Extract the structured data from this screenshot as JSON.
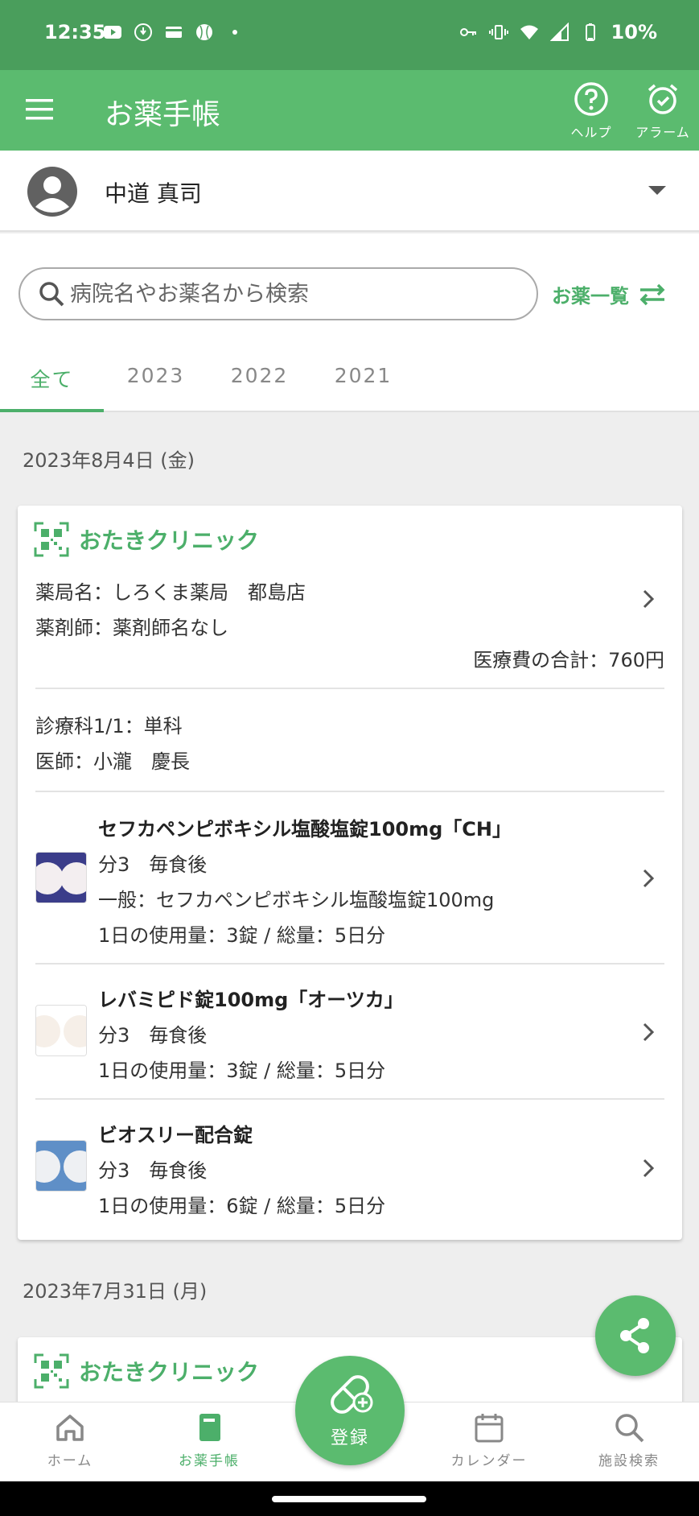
{
  "status_bar": {
    "time": "12:35",
    "battery": "10%"
  },
  "app_bar": {
    "title": "お薬手帳",
    "help_label": "ヘルプ",
    "alarm_label": "アラーム"
  },
  "user": {
    "name": "中道 真司"
  },
  "search": {
    "placeholder": "病院名やお薬名から検索",
    "list_link": "お薬一覧"
  },
  "tabs": [
    "全て",
    "2023",
    "2022",
    "2021"
  ],
  "records": [
    {
      "date": "2023年8月4日 (金)",
      "clinic": "おたきクリニック",
      "pharmacy": "薬局名：しろくま薬局　都島店",
      "pharmacist": "薬剤師：薬剤師名なし",
      "total_cost": "医療費の合計：760円",
      "department": "診療科1/1：単科",
      "doctor": "医師：小瀧　慶長",
      "medications": [
        {
          "name": "セフカペンピボキシル塩酸塩錠100mg「CH」",
          "dosage": "分3　毎食後",
          "generic": "一般：セフカペンピボキシル塩酸塩錠100mg",
          "usage": "1日の使用量：3錠 / 総量：5日分"
        },
        {
          "name": "レバミピド錠100mg「オーツカ」",
          "dosage": "分3　毎食後",
          "usage": "1日の使用量：3錠 / 総量：5日分"
        },
        {
          "name": "ビオスリー配合錠",
          "dosage": "分3　毎食後",
          "usage": "1日の使用量：6錠 / 総量：5日分"
        }
      ]
    },
    {
      "date": "2023年7月31日 (月)",
      "clinic": "おたきクリニック"
    }
  ],
  "bottom_nav": {
    "home": "ホーム",
    "notebook": "お薬手帳",
    "register": "登録",
    "calendar": "カレンダー",
    "facility_search": "施設検索"
  },
  "colors": {
    "accent": "#5bbb6f",
    "status_bar": "#4a9e5c",
    "accent_text": "#4caf6a"
  }
}
